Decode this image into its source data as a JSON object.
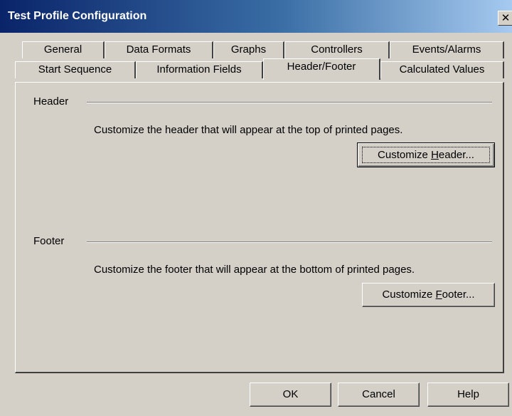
{
  "window": {
    "title": "Test Profile Configuration",
    "close_glyph": "✕"
  },
  "tabs": {
    "row_top": [
      "General",
      "Data Formats",
      "Graphs",
      "Controllers",
      "Events/Alarms"
    ],
    "row_bottom": [
      "Start Sequence",
      "Information Fields",
      "Header/Footer",
      "Calculated Values"
    ],
    "active": "Header/Footer"
  },
  "header_group": {
    "label": "Header",
    "description": "Customize the header that will appear at the top of printed pages.",
    "button_pre": "Customize ",
    "button_mnemonic": "H",
    "button_post": "eader..."
  },
  "footer_group": {
    "label": "Footer",
    "description": "Customize the footer that will appear at the bottom of printed pages.",
    "button_pre": "Customize ",
    "button_mnemonic": "F",
    "button_post": "ooter..."
  },
  "buttons": {
    "ok": "OK",
    "cancel": "Cancel",
    "help": "Help"
  }
}
